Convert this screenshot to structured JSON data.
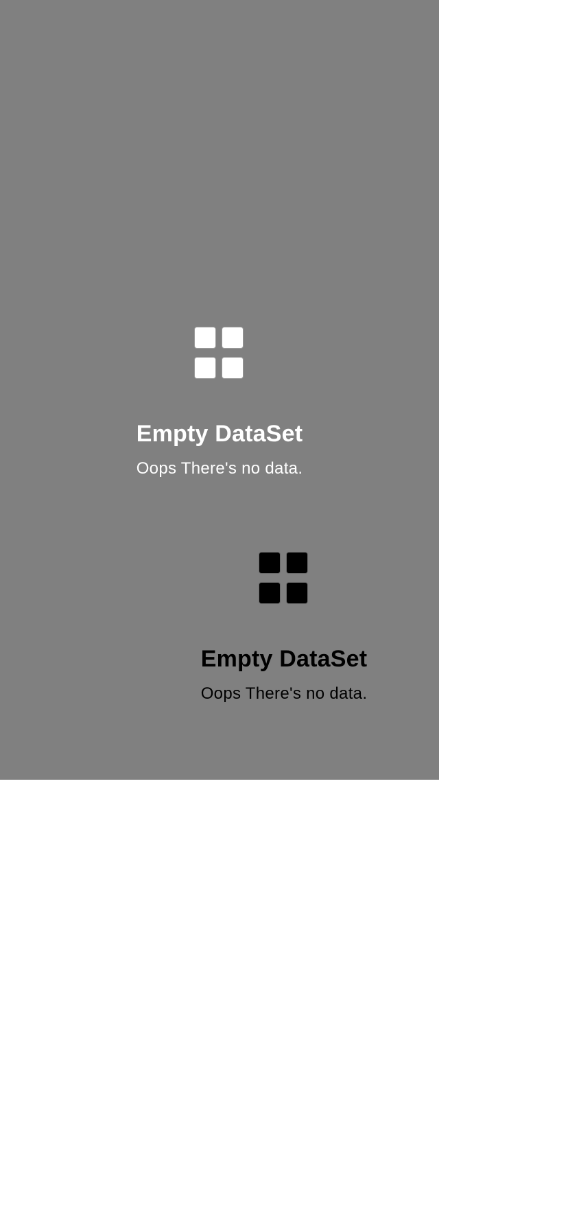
{
  "empty_states": [
    {
      "icon": "grid-icon",
      "title": "Empty DataSet",
      "subtitle": "Oops There's no data.",
      "color": "#ffffff"
    },
    {
      "icon": "grid-icon",
      "title": "Empty DataSet",
      "subtitle": "Oops There's no data.",
      "color": "#000000"
    }
  ],
  "colors": {
    "panel_background": "#808080",
    "page_background": "#ffffff"
  }
}
